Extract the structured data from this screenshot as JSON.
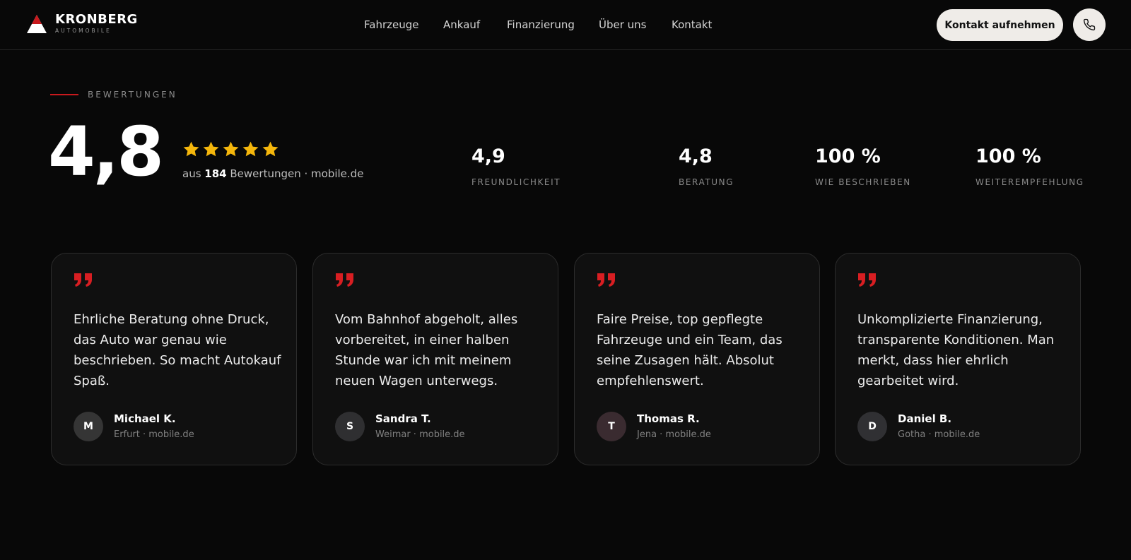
{
  "brand": {
    "name": "KRONBERG",
    "sub": "AUTOMOBILE",
    "accent": "#c8191d"
  },
  "nav": {
    "items": [
      {
        "label": "Fahrzeuge"
      },
      {
        "label": "Ankauf"
      },
      {
        "label": "Finanzierung"
      },
      {
        "label": "Über uns"
      },
      {
        "label": "Kontakt"
      }
    ],
    "cta_label": "Kontakt aufnehmen",
    "phone_icon": "phone-icon"
  },
  "reviews": {
    "section_label": "BEWERTUNGEN",
    "overall_rating": "4,8",
    "stars": 5,
    "star_color": "#f5b70c",
    "sub_prefix": "aus",
    "count": "184",
    "sub_suffix": "Bewertungen · mobile.de",
    "stats": [
      {
        "value": "4,9",
        "label": "FREUNDLICHKEIT"
      },
      {
        "value": "4,8",
        "label": "BERATUNG"
      },
      {
        "value": "100 %",
        "label": "WIE BESCHRIEBEN"
      },
      {
        "value": "100 %",
        "label": "WEITEREMPFEHLUNG"
      }
    ],
    "cards": [
      {
        "text": "Ehrliche Beratung ohne Druck, das Auto war genau wie beschrieben. So macht Autokauf Spaß.",
        "initial": "M",
        "name": "Michael K.",
        "meta": "Erfurt · mobile.de",
        "avatar_color": "#353535"
      },
      {
        "text": "Vom Bahnhof abgeholt, alles vorbereitet, in einer halben Stunde war ich mit meinem neuen Wagen unterwegs.",
        "initial": "S",
        "name": "Sandra T.",
        "meta": "Weimar · mobile.de",
        "avatar_color": "#2f2f31"
      },
      {
        "text": "Faire Preise, top gepflegte Fahrzeuge und ein Team, das seine Zusagen hält. Absolut empfehlenswert.",
        "initial": "T",
        "name": "Thomas R.",
        "meta": "Jena · mobile.de",
        "avatar_color": "#3a2b30"
      },
      {
        "text": "Unkomplizierte Finanzierung, transparente Konditionen. Man merkt, dass hier ehrlich gearbeitet wird.",
        "initial": "D",
        "name": "Daniel B.",
        "meta": "Gotha · mobile.de",
        "avatar_color": "#303033"
      }
    ]
  }
}
